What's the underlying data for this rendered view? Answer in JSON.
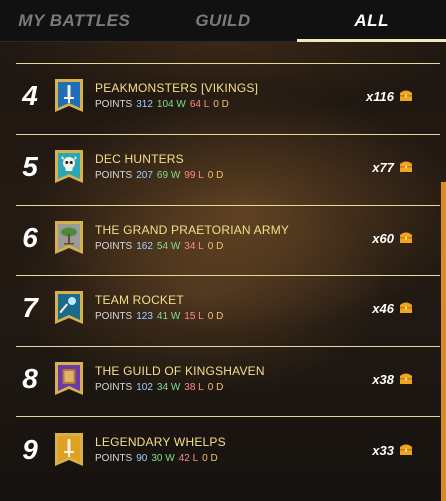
{
  "tabs": [
    {
      "label": "MY BATTLES",
      "active": false
    },
    {
      "label": "GUILD",
      "active": false
    },
    {
      "label": "ALL",
      "active": true
    }
  ],
  "labels": {
    "points": "POINTS"
  },
  "guilds": [
    {
      "rank": "4",
      "name": "PEAKMONSTERS [VIKINGS]",
      "points": "312",
      "wins": "104 W",
      "losses": "64 L",
      "draws": "0 D",
      "reward": "x116",
      "banner": "sword-crest",
      "banner_color": "#1e6fb8"
    },
    {
      "rank": "5",
      "name": "DEC HUNTERS",
      "points": "207",
      "wins": "69 W",
      "losses": "99 L",
      "draws": "0 D",
      "reward": "x77",
      "banner": "skull-crest",
      "banner_color": "#2aa6b8"
    },
    {
      "rank": "6",
      "name": "THE GRAND PRAETORIAN ARMY",
      "points": "162",
      "wins": "54 W",
      "losses": "34 L",
      "draws": "0 D",
      "reward": "x60",
      "banner": "tree-crest",
      "banner_color": "#9a9a9a"
    },
    {
      "rank": "7",
      "name": "TEAM ROCKET",
      "points": "123",
      "wins": "41 W",
      "losses": "15 L",
      "draws": "0 D",
      "reward": "x46",
      "banner": "wand-crest",
      "banner_color": "#1a6b8a"
    },
    {
      "rank": "8",
      "name": "THE GUILD OF KINGSHAVEN",
      "points": "102",
      "wins": "34 W",
      "losses": "38 L",
      "draws": "0 D",
      "reward": "x38",
      "banner": "book-crest",
      "banner_color": "#6a3aa8"
    },
    {
      "rank": "9",
      "name": "LEGENDARY WHELPS",
      "points": "90",
      "wins": "30 W",
      "losses": "42 L",
      "draws": "0 D",
      "reward": "x33",
      "banner": "sword-crest",
      "banner_color": "#e0a020"
    }
  ],
  "colors": {
    "accent": "#f0e9b8",
    "separator": "#e6d9a0",
    "name": "#f1e08a",
    "scrollbar": "#d98c1a"
  },
  "icons": {
    "reward": "gold-chest-icon"
  }
}
